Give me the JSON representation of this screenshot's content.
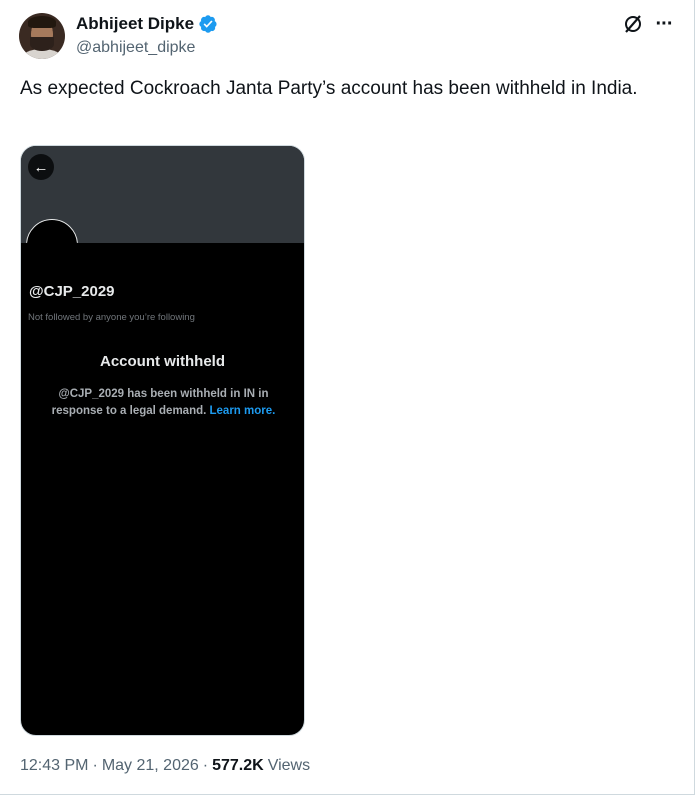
{
  "author": {
    "display_name": "Abhijeet Dipke",
    "handle": "@abhijeet_dipke",
    "verified": true,
    "verified_color": "#1d9bf0"
  },
  "icons": {
    "grok": "grok-icon",
    "more": "more-horizontal-icon",
    "back": "back-arrow-icon",
    "verified": "verified-badge-icon"
  },
  "tweet": {
    "text": "As expected Cockroach Janta Party’s account has been withheld in India."
  },
  "media": {
    "profile_handle": "@CJP_2029",
    "not_followed_text": "Not followed by anyone you’re following",
    "withheld_title": "Account withheld",
    "withheld_body": "@CJP_2029 has been withheld in IN in response to a legal demand.",
    "learn_more": "Learn more."
  },
  "meta": {
    "time": "12:43 PM",
    "sep1": "·",
    "date": "May 21, 2026",
    "sep2": "·",
    "views_count": "577.2K",
    "views_label": "Views"
  }
}
